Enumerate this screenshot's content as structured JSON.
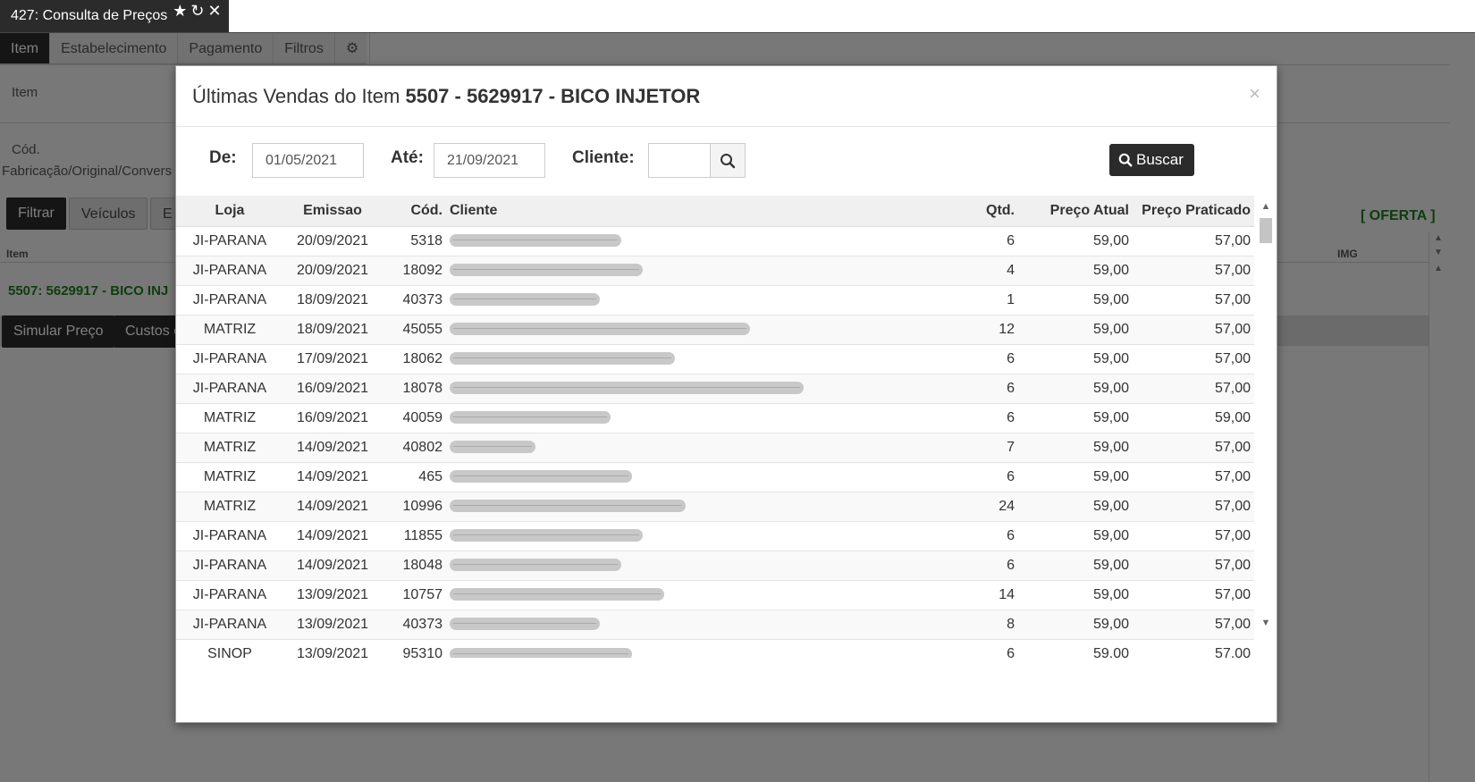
{
  "window_tab": {
    "title": "427: Consulta de Preços"
  },
  "app": {
    "sub_tabs": [
      "Item",
      "Estabelecimento",
      "Pagamento",
      "Filtros"
    ],
    "item_label": "Item",
    "cod_label_1": "Cód.",
    "cod_label_2": "Fabricação/Original/Convers",
    "filtrar_label": "Filtrar",
    "veiculos_label": "Veículos",
    "third_btn_label": "E",
    "oferta_label": "[ OFERTA ]",
    "list_header_item": "Item",
    "list_header_img": "IMG",
    "item_row_text": "5507: 5629917 - BICO INJ",
    "simular_label": "Simular Preço",
    "custos_label": "Custos c"
  },
  "modal": {
    "title_prefix": "Últimas Vendas do Item",
    "title_item": "5507 - 5629917 - BICO INJETOR",
    "close": "×",
    "de_label": "De:",
    "de_value": "01/05/2021",
    "ate_label": "Até:",
    "ate_value": "21/09/2021",
    "cliente_label": "Cliente:",
    "cliente_value": "",
    "buscar_label": "Buscar"
  },
  "table": {
    "headers": {
      "loja": "Loja",
      "emissao": "Emissao",
      "cod": "Cód.",
      "cliente": "Cliente",
      "qtd": "Qtd.",
      "preco_atual": "Preço Atual",
      "preco_praticado": "Preço Praticado"
    },
    "rows": [
      {
        "loja": "JI-PARANA",
        "emissao": "20/09/2021",
        "cod": "5318",
        "qtd": "6",
        "preco_atual": "59,00",
        "preco_praticado": "57,00",
        "cliente_redacted": 0.16
      },
      {
        "loja": "JI-PARANA",
        "emissao": "20/09/2021",
        "cod": "18092",
        "qtd": "4",
        "preco_atual": "59,00",
        "preco_praticado": "57,00",
        "cliente_redacted": 0.18
      },
      {
        "loja": "JI-PARANA",
        "emissao": "18/09/2021",
        "cod": "40373",
        "qtd": "1",
        "preco_atual": "59,00",
        "preco_praticado": "57,00",
        "cliente_redacted": 0.14
      },
      {
        "loja": "MATRIZ",
        "emissao": "18/09/2021",
        "cod": "45055",
        "qtd": "12",
        "preco_atual": "59,00",
        "preco_praticado": "57,00",
        "cliente_redacted": 0.28
      },
      {
        "loja": "JI-PARANA",
        "emissao": "17/09/2021",
        "cod": "18062",
        "qtd": "6",
        "preco_atual": "59,00",
        "preco_praticado": "57,00",
        "cliente_redacted": 0.21
      },
      {
        "loja": "JI-PARANA",
        "emissao": "16/09/2021",
        "cod": "18078",
        "qtd": "6",
        "preco_atual": "59,00",
        "preco_praticado": "57,00",
        "cliente_redacted": 0.33
      },
      {
        "loja": "MATRIZ",
        "emissao": "16/09/2021",
        "cod": "40059",
        "qtd": "6",
        "preco_atual": "59,00",
        "preco_praticado": "59,00",
        "cliente_redacted": 0.15
      },
      {
        "loja": "MATRIZ",
        "emissao": "14/09/2021",
        "cod": "40802",
        "qtd": "7",
        "preco_atual": "59,00",
        "preco_praticado": "57,00",
        "cliente_redacted": 0.08
      },
      {
        "loja": "MATRIZ",
        "emissao": "14/09/2021",
        "cod": "465",
        "qtd": "6",
        "preco_atual": "59,00",
        "preco_praticado": "57,00",
        "cliente_redacted": 0.17
      },
      {
        "loja": "MATRIZ",
        "emissao": "14/09/2021",
        "cod": "10996",
        "qtd": "24",
        "preco_atual": "59,00",
        "preco_praticado": "57,00",
        "cliente_redacted": 0.22
      },
      {
        "loja": "JI-PARANA",
        "emissao": "14/09/2021",
        "cod": "11855",
        "qtd": "6",
        "preco_atual": "59,00",
        "preco_praticado": "57,00",
        "cliente_redacted": 0.18
      },
      {
        "loja": "JI-PARANA",
        "emissao": "14/09/2021",
        "cod": "18048",
        "qtd": "6",
        "preco_atual": "59,00",
        "preco_praticado": "57,00",
        "cliente_redacted": 0.16
      },
      {
        "loja": "JI-PARANA",
        "emissao": "13/09/2021",
        "cod": "10757",
        "qtd": "14",
        "preco_atual": "59,00",
        "preco_praticado": "57,00",
        "cliente_redacted": 0.2
      },
      {
        "loja": "JI-PARANA",
        "emissao": "13/09/2021",
        "cod": "40373",
        "qtd": "8",
        "preco_atual": "59,00",
        "preco_praticado": "57,00",
        "cliente_redacted": 0.14
      },
      {
        "loja": "SINOP",
        "emissao": "13/09/2021",
        "cod": "95310",
        "qtd": "6",
        "preco_atual": "59,00",
        "preco_praticado": "57,00",
        "cliente_redacted": 0.17
      }
    ]
  },
  "icons": {
    "star": "star-icon",
    "refresh": "refresh-icon",
    "close": "close-icon",
    "cog": "cogs-icon",
    "search": "search-icon"
  }
}
